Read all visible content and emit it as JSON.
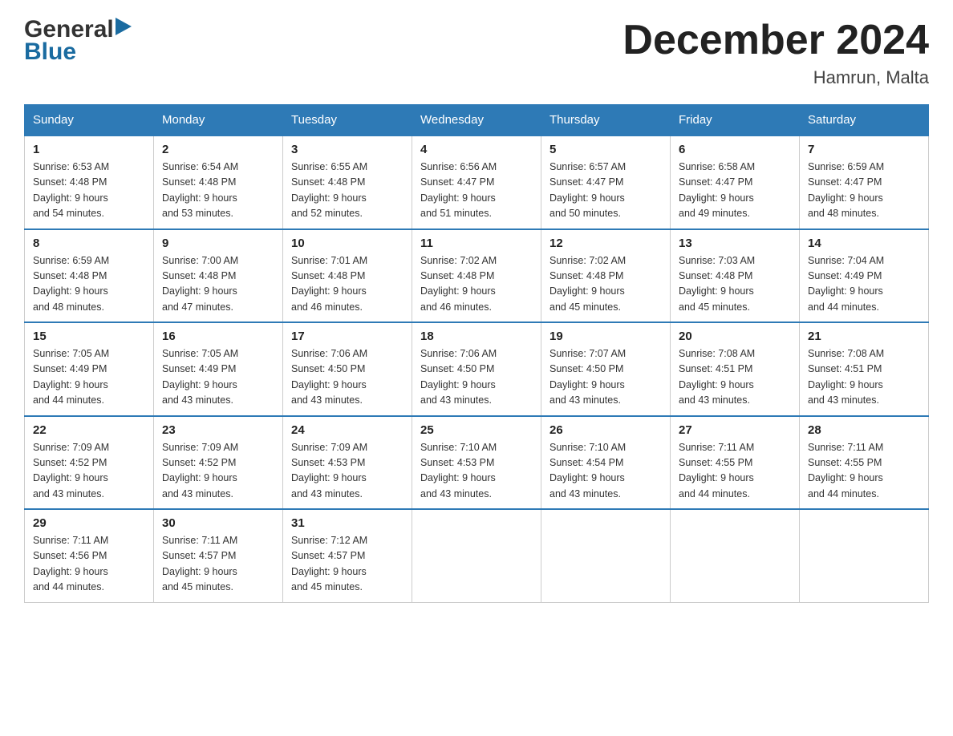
{
  "header": {
    "logo_general": "General",
    "logo_blue": "Blue",
    "title": "December 2024",
    "location": "Hamrun, Malta"
  },
  "weekdays": [
    "Sunday",
    "Monday",
    "Tuesday",
    "Wednesday",
    "Thursday",
    "Friday",
    "Saturday"
  ],
  "weeks": [
    [
      {
        "day": "1",
        "sunrise": "6:53 AM",
        "sunset": "4:48 PM",
        "daylight": "9 hours and 54 minutes."
      },
      {
        "day": "2",
        "sunrise": "6:54 AM",
        "sunset": "4:48 PM",
        "daylight": "9 hours and 53 minutes."
      },
      {
        "day": "3",
        "sunrise": "6:55 AM",
        "sunset": "4:48 PM",
        "daylight": "9 hours and 52 minutes."
      },
      {
        "day": "4",
        "sunrise": "6:56 AM",
        "sunset": "4:47 PM",
        "daylight": "9 hours and 51 minutes."
      },
      {
        "day": "5",
        "sunrise": "6:57 AM",
        "sunset": "4:47 PM",
        "daylight": "9 hours and 50 minutes."
      },
      {
        "day": "6",
        "sunrise": "6:58 AM",
        "sunset": "4:47 PM",
        "daylight": "9 hours and 49 minutes."
      },
      {
        "day": "7",
        "sunrise": "6:59 AM",
        "sunset": "4:47 PM",
        "daylight": "9 hours and 48 minutes."
      }
    ],
    [
      {
        "day": "8",
        "sunrise": "6:59 AM",
        "sunset": "4:48 PM",
        "daylight": "9 hours and 48 minutes."
      },
      {
        "day": "9",
        "sunrise": "7:00 AM",
        "sunset": "4:48 PM",
        "daylight": "9 hours and 47 minutes."
      },
      {
        "day": "10",
        "sunrise": "7:01 AM",
        "sunset": "4:48 PM",
        "daylight": "9 hours and 46 minutes."
      },
      {
        "day": "11",
        "sunrise": "7:02 AM",
        "sunset": "4:48 PM",
        "daylight": "9 hours and 46 minutes."
      },
      {
        "day": "12",
        "sunrise": "7:02 AM",
        "sunset": "4:48 PM",
        "daylight": "9 hours and 45 minutes."
      },
      {
        "day": "13",
        "sunrise": "7:03 AM",
        "sunset": "4:48 PM",
        "daylight": "9 hours and 45 minutes."
      },
      {
        "day": "14",
        "sunrise": "7:04 AM",
        "sunset": "4:49 PM",
        "daylight": "9 hours and 44 minutes."
      }
    ],
    [
      {
        "day": "15",
        "sunrise": "7:05 AM",
        "sunset": "4:49 PM",
        "daylight": "9 hours and 44 minutes."
      },
      {
        "day": "16",
        "sunrise": "7:05 AM",
        "sunset": "4:49 PM",
        "daylight": "9 hours and 43 minutes."
      },
      {
        "day": "17",
        "sunrise": "7:06 AM",
        "sunset": "4:50 PM",
        "daylight": "9 hours and 43 minutes."
      },
      {
        "day": "18",
        "sunrise": "7:06 AM",
        "sunset": "4:50 PM",
        "daylight": "9 hours and 43 minutes."
      },
      {
        "day": "19",
        "sunrise": "7:07 AM",
        "sunset": "4:50 PM",
        "daylight": "9 hours and 43 minutes."
      },
      {
        "day": "20",
        "sunrise": "7:08 AM",
        "sunset": "4:51 PM",
        "daylight": "9 hours and 43 minutes."
      },
      {
        "day": "21",
        "sunrise": "7:08 AM",
        "sunset": "4:51 PM",
        "daylight": "9 hours and 43 minutes."
      }
    ],
    [
      {
        "day": "22",
        "sunrise": "7:09 AM",
        "sunset": "4:52 PM",
        "daylight": "9 hours and 43 minutes."
      },
      {
        "day": "23",
        "sunrise": "7:09 AM",
        "sunset": "4:52 PM",
        "daylight": "9 hours and 43 minutes."
      },
      {
        "day": "24",
        "sunrise": "7:09 AM",
        "sunset": "4:53 PM",
        "daylight": "9 hours and 43 minutes."
      },
      {
        "day": "25",
        "sunrise": "7:10 AM",
        "sunset": "4:53 PM",
        "daylight": "9 hours and 43 minutes."
      },
      {
        "day": "26",
        "sunrise": "7:10 AM",
        "sunset": "4:54 PM",
        "daylight": "9 hours and 43 minutes."
      },
      {
        "day": "27",
        "sunrise": "7:11 AM",
        "sunset": "4:55 PM",
        "daylight": "9 hours and 44 minutes."
      },
      {
        "day": "28",
        "sunrise": "7:11 AM",
        "sunset": "4:55 PM",
        "daylight": "9 hours and 44 minutes."
      }
    ],
    [
      {
        "day": "29",
        "sunrise": "7:11 AM",
        "sunset": "4:56 PM",
        "daylight": "9 hours and 44 minutes."
      },
      {
        "day": "30",
        "sunrise": "7:11 AM",
        "sunset": "4:57 PM",
        "daylight": "9 hours and 45 minutes."
      },
      {
        "day": "31",
        "sunrise": "7:12 AM",
        "sunset": "4:57 PM",
        "daylight": "9 hours and 45 minutes."
      },
      null,
      null,
      null,
      null
    ]
  ],
  "labels": {
    "sunrise": "Sunrise: ",
    "sunset": "Sunset: ",
    "daylight": "Daylight: "
  }
}
